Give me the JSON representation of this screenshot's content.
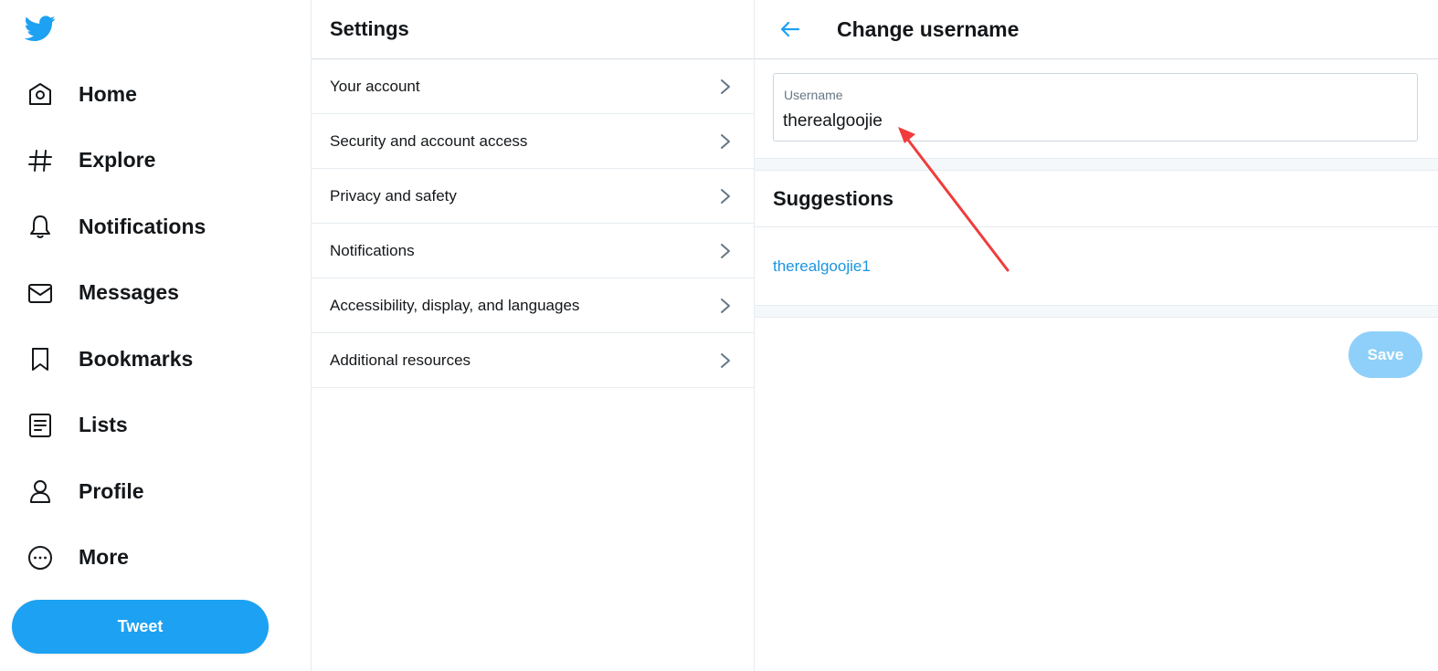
{
  "nav": {
    "items": [
      {
        "label": "Home",
        "icon": "home-icon"
      },
      {
        "label": "Explore",
        "icon": "hashtag-icon"
      },
      {
        "label": "Notifications",
        "icon": "bell-icon"
      },
      {
        "label": "Messages",
        "icon": "envelope-icon"
      },
      {
        "label": "Bookmarks",
        "icon": "bookmark-icon"
      },
      {
        "label": "Lists",
        "icon": "list-icon"
      },
      {
        "label": "Profile",
        "icon": "user-icon"
      },
      {
        "label": "More",
        "icon": "more-icon"
      }
    ],
    "tweet_label": "Tweet"
  },
  "settings": {
    "title": "Settings",
    "items": [
      {
        "label": "Your account"
      },
      {
        "label": "Security and account access"
      },
      {
        "label": "Privacy and safety"
      },
      {
        "label": "Notifications"
      },
      {
        "label": "Accessibility, display, and languages"
      },
      {
        "label": "Additional resources"
      }
    ]
  },
  "detail": {
    "title": "Change username",
    "field_label": "Username",
    "field_value": "therealgoojie",
    "suggestions_title": "Suggestions",
    "suggestion": "therealgoojie1",
    "save_label": "Save"
  },
  "colors": {
    "brand": "#1da1f2",
    "link": "#1b95e0",
    "save_disabled": "#8ed0f9",
    "annotation": "#f03c3c"
  }
}
